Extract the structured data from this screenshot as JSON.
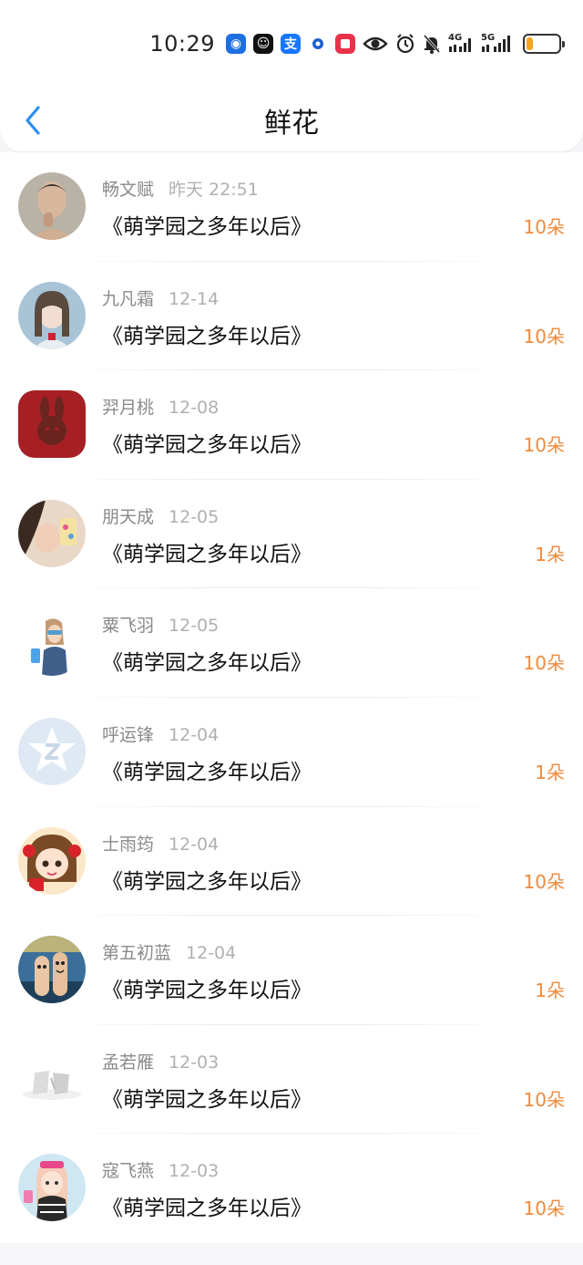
{
  "status_bar": {
    "time": "10:29",
    "net_4g": "4G",
    "net_5g": "5G",
    "battery_level": 0.22
  },
  "header": {
    "title": "鲜花"
  },
  "records": [
    {
      "name": "畅文赋",
      "date": "昨天 22:51",
      "book": "《萌学园之多年以后》",
      "count": "10朵"
    },
    {
      "name": "九凡霜",
      "date": "12-14",
      "book": "《萌学园之多年以后》",
      "count": "10朵"
    },
    {
      "name": "羿月桃",
      "date": "12-08",
      "book": "《萌学园之多年以后》",
      "count": "10朵"
    },
    {
      "name": "朋天成",
      "date": "12-05",
      "book": "《萌学园之多年以后》",
      "count": "1朵"
    },
    {
      "name": "粟飞羽",
      "date": "12-05",
      "book": "《萌学园之多年以后》",
      "count": "10朵"
    },
    {
      "name": "呼运锋",
      "date": "12-04",
      "book": "《萌学园之多年以后》",
      "count": "1朵"
    },
    {
      "name": "士雨筠",
      "date": "12-04",
      "book": "《萌学园之多年以后》",
      "count": "10朵"
    },
    {
      "name": "第五初蓝",
      "date": "12-04",
      "book": "《萌学园之多年以后》",
      "count": "1朵"
    },
    {
      "name": "孟若雁",
      "date": "12-03",
      "book": "《萌学园之多年以后》",
      "count": "10朵"
    },
    {
      "name": "寇飞燕",
      "date": "12-03",
      "book": "《萌学园之多年以后》",
      "count": "10朵"
    }
  ],
  "colors": {
    "accent_blue": "#2b8ff0",
    "count_orange": "#f08a3c",
    "name_gray": "#8a8a8a",
    "date_gray": "#b0b0b0"
  }
}
